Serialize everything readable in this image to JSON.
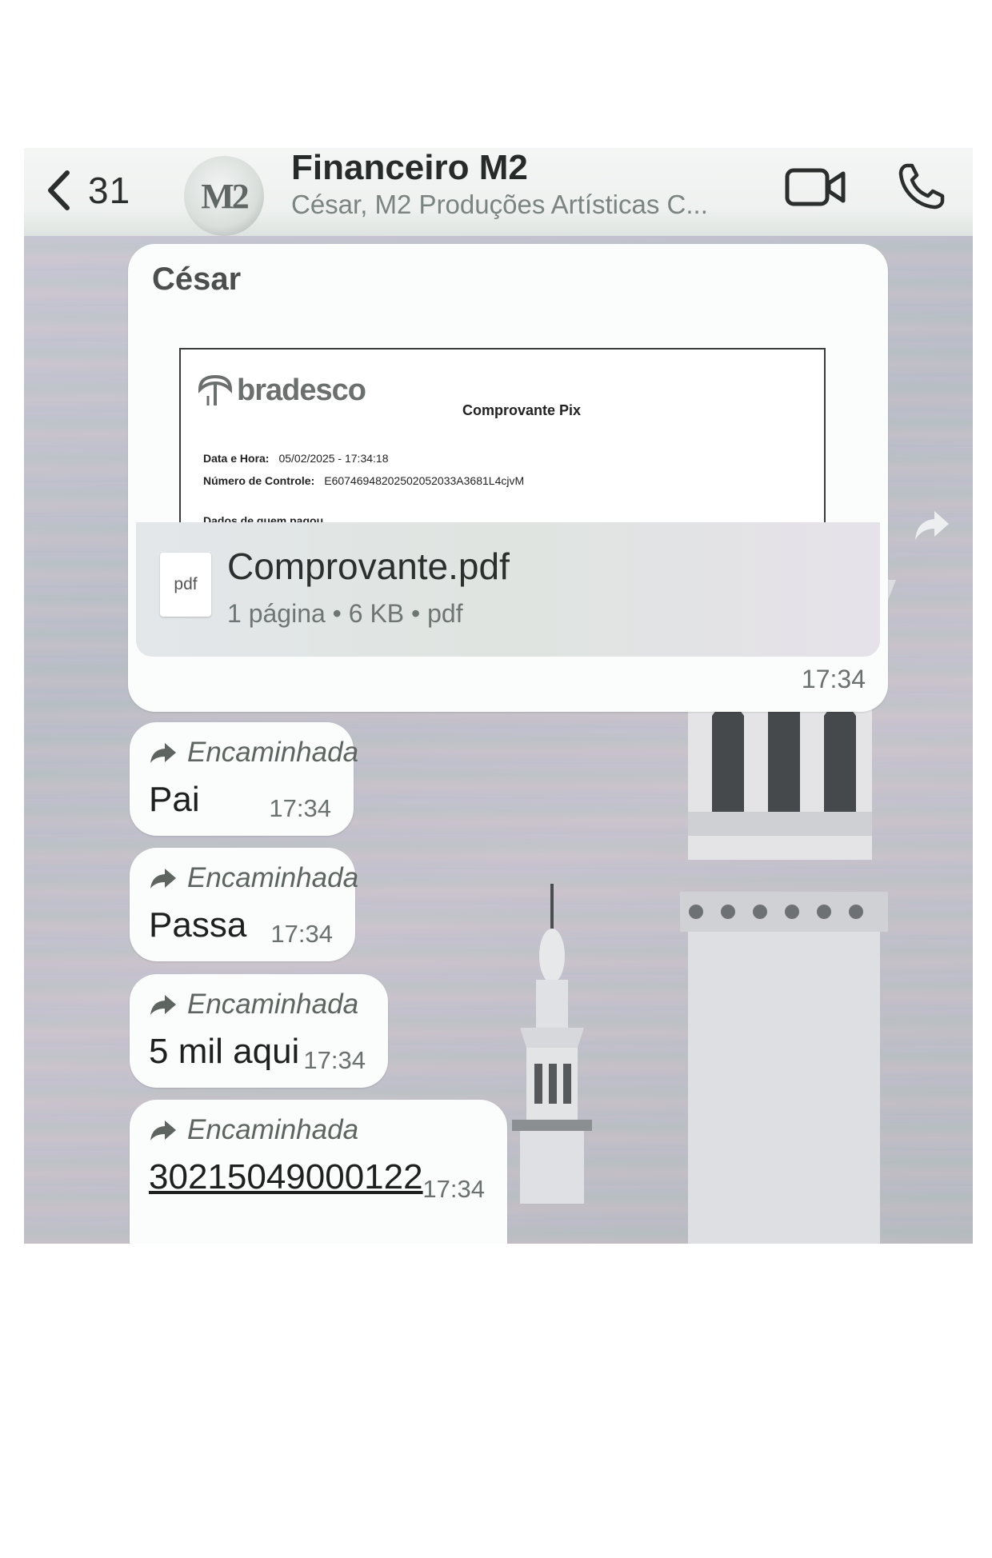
{
  "header": {
    "back_count": "31",
    "title": "Financeiro M2",
    "subtitle": "César, M2 Produções Artísticas C...",
    "avatar_text": "M2"
  },
  "document_message": {
    "sender": "César",
    "preview": {
      "bank_name": "bradesco",
      "receipt_title": "Comprovante Pix",
      "date_label": "Data e Hora:",
      "date_value": "05/02/2025 - 17:34:18",
      "control_label": "Número de Controle:",
      "control_value": "E60746948202502052033A3681L4cjvM",
      "section_label": "Dados de quem pagou"
    },
    "file_icon_label": "pdf",
    "file_name": "Comprovante.pdf",
    "file_meta": "1 página • 6 KB • pdf",
    "time": "17:34"
  },
  "forwarded_messages": [
    {
      "label": "Encaminhada",
      "text": "Pai",
      "time": "17:34"
    },
    {
      "label": "Encaminhada",
      "text": "Passa",
      "time": "17:34"
    },
    {
      "label": "Encaminhada",
      "text": "5 mil aqui",
      "time": "17:34"
    },
    {
      "label": "Encaminhada",
      "text": "30215049000122",
      "time": "17:34"
    }
  ],
  "icons": {
    "back": "chevron-left-icon",
    "video": "video-camera-icon",
    "phone": "phone-icon",
    "forward": "share-arrow-icon",
    "file": "pdf-file-icon"
  },
  "colors": {
    "bubble": "#fbfcfc",
    "header": "#eef1ef",
    "text_primary": "#1d201f",
    "text_secondary": "#6a716e"
  }
}
